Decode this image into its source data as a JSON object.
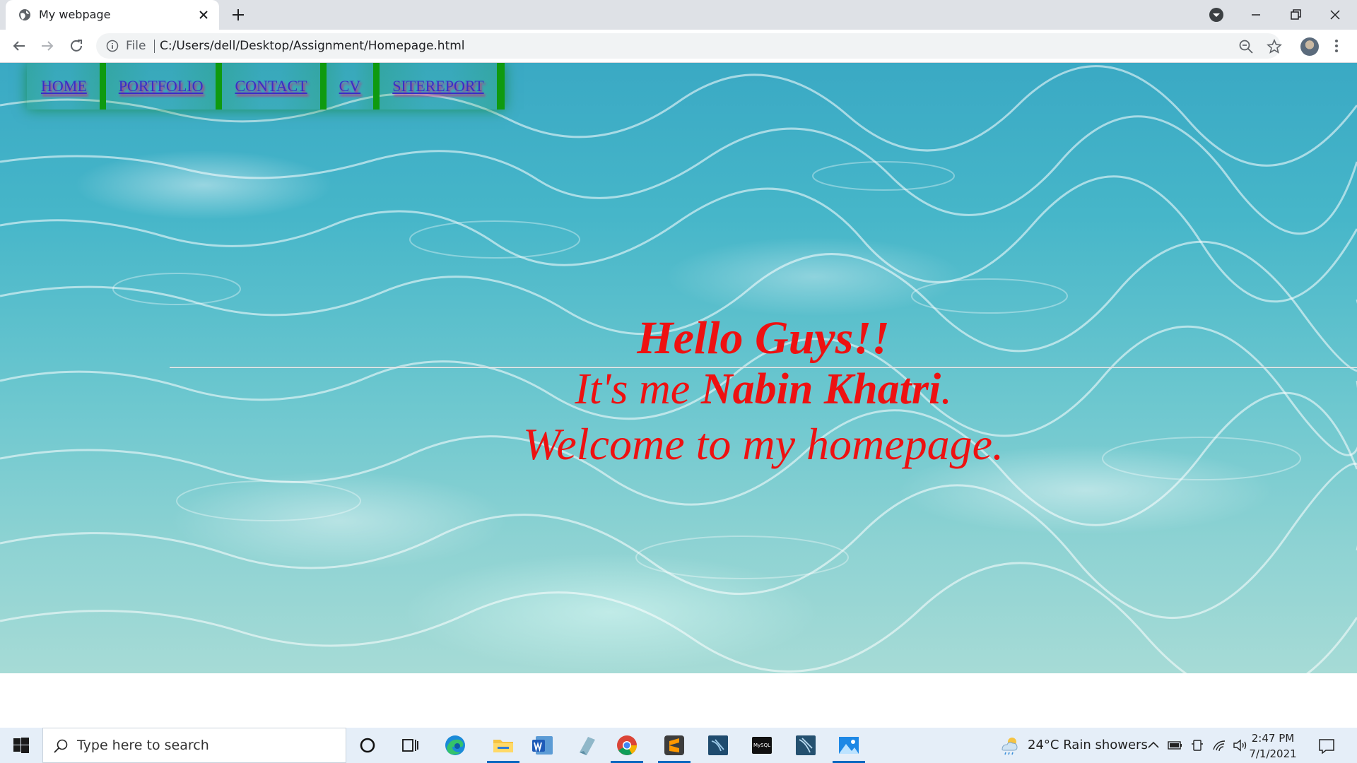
{
  "browser": {
    "tab_title": "My webpage",
    "url_scheme": "File",
    "url": "C:/Users/dell/Desktop/Assignment/Homepage.html"
  },
  "page": {
    "nav": [
      "HOME",
      "PORTFOLIO",
      "CONTACT",
      "CV",
      "SITEREPORT"
    ],
    "greeting": "Hello Guys!!",
    "intro_prefix": "It's me ",
    "intro_name": "Nabin Khatri",
    "intro_suffix": ".",
    "welcome": "Welcome to my homepage.",
    "heading_color": "#ee1111",
    "link_color": "#3b2cc8",
    "nav_border_color": "#0f9a0f"
  },
  "taskbar": {
    "search_placeholder": "Type here to search",
    "weather": "24°C  Rain showers",
    "time": "2:47 PM",
    "date": "7/1/2021",
    "apps": [
      "cortana-icon",
      "task-view-icon",
      "edge-icon",
      "file-explorer-icon",
      "word-icon",
      "app-icon",
      "chrome-icon",
      "sublime-icon",
      "mysql-workbench-icon",
      "mysql-icon",
      "mysql-workbench-icon",
      "photos-icon"
    ]
  }
}
